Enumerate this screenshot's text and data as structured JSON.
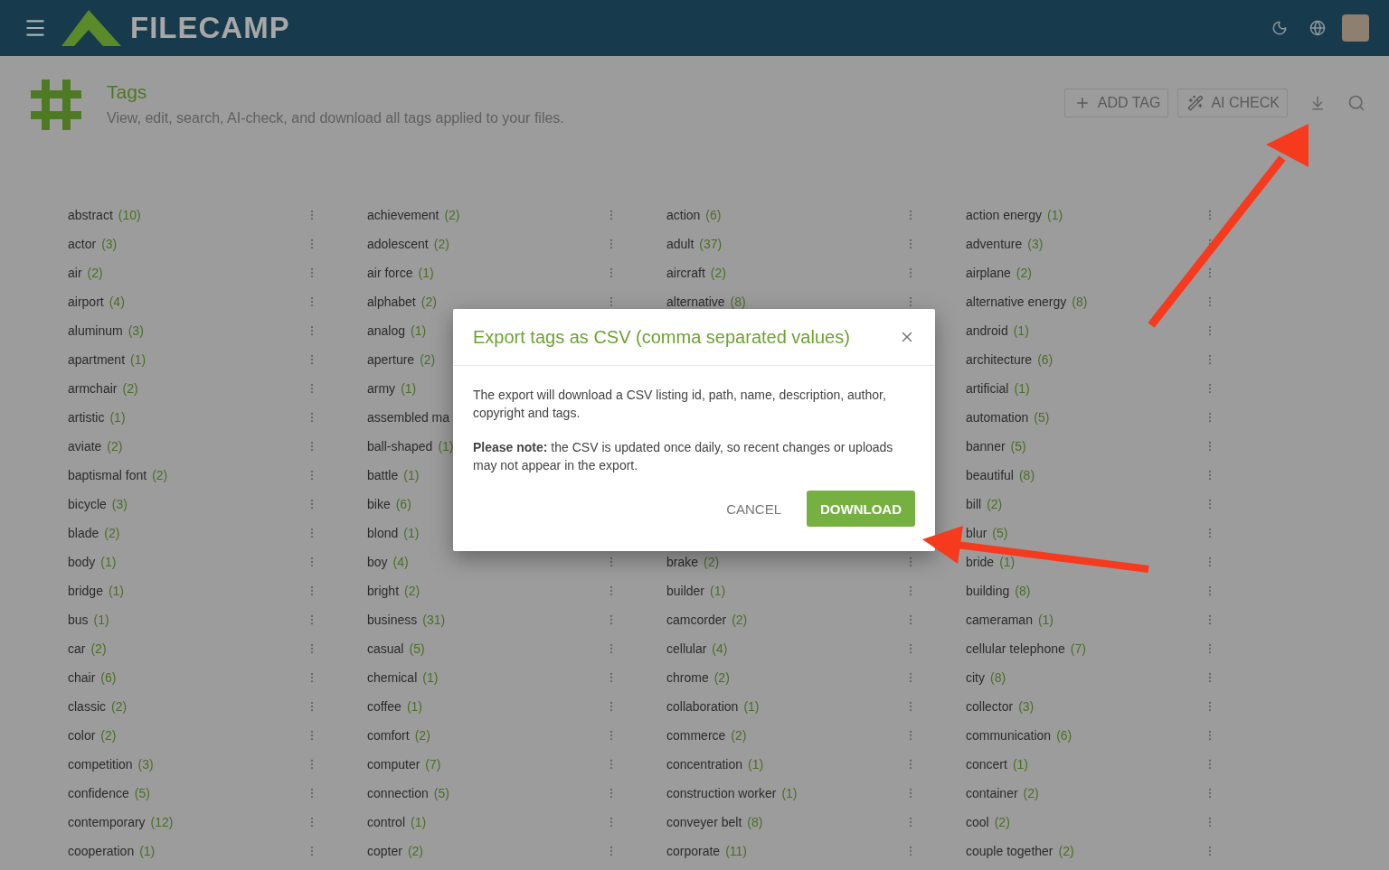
{
  "header": {
    "logo": "FILECAMP"
  },
  "page": {
    "title": "Tags",
    "subtitle": "View, edit, search, AI-check, and download all tags applied to your files."
  },
  "actions": [
    "ADD TAG",
    "AI CHECK"
  ],
  "columns": [
    [
      {
        "kind": "tag",
        "name": "abstract",
        "count": "(10)"
      },
      {
        "kind": "tag",
        "name": "actor",
        "count": "(3)"
      },
      {
        "kind": "tag",
        "name": "air",
        "count": "(2)"
      },
      {
        "kind": "tag",
        "name": "airport",
        "count": "(4)"
      },
      {
        "kind": "tag",
        "name": "aluminum",
        "count": "(3)"
      },
      {
        "kind": "tag",
        "name": "apartment",
        "count": "(1)"
      },
      {
        "kind": "tag",
        "name": "armchair",
        "count": "(2)"
      },
      {
        "kind": "tag",
        "name": "artistic",
        "count": "(1)"
      },
      {
        "kind": "tag",
        "name": "aviate",
        "count": "(2)"
      },
      {
        "kind": "tag",
        "name": "baptismal font",
        "count": "(2)"
      },
      {
        "kind": "tag",
        "name": "bicycle",
        "count": "(3)"
      },
      {
        "kind": "tag",
        "name": "blade",
        "count": "(2)"
      },
      {
        "kind": "tag",
        "name": "body",
        "count": "(1)"
      },
      {
        "kind": "tag",
        "name": "bridge",
        "count": "(1)"
      },
      {
        "kind": "tag",
        "name": "bus",
        "count": "(1)"
      },
      {
        "kind": "tag",
        "name": "car",
        "count": "(2)"
      },
      {
        "kind": "tag",
        "name": "chair",
        "count": "(6)"
      },
      {
        "kind": "tag",
        "name": "classic",
        "count": "(2)"
      },
      {
        "kind": "tag",
        "name": "color",
        "count": "(2)"
      },
      {
        "kind": "tag",
        "name": "competition",
        "count": "(3)"
      },
      {
        "kind": "tag",
        "name": "confidence",
        "count": "(5)"
      },
      {
        "kind": "tag",
        "name": "contemporary",
        "count": "(12)"
      },
      {
        "kind": "tag",
        "name": "cooperation",
        "count": "(1)"
      }
    ],
    [
      {
        "kind": "tag",
        "name": "achievement",
        "count": "(2)"
      },
      {
        "kind": "tag",
        "name": "adolescent",
        "count": "(2)"
      },
      {
        "kind": "tag",
        "name": "air force",
        "count": "(1)"
      },
      {
        "kind": "tag",
        "name": "alphabet",
        "count": "(2)"
      },
      {
        "kind": "partial",
        "name": "analog",
        "count": "(1)"
      },
      {
        "kind": "partial",
        "name": "aperture",
        "count": "(2)"
      },
      {
        "kind": "partial",
        "name": "army",
        "count": "(1)"
      },
      {
        "kind": "partial",
        "name": "assembled ma"
      },
      {
        "kind": "partial",
        "name": "ball-shaped",
        "count": "(1)"
      },
      {
        "kind": "partial",
        "name": "battle",
        "count": "(1)"
      },
      {
        "kind": "partial",
        "name": "bike",
        "count": "(6)"
      },
      {
        "kind": "partial",
        "name": "blond",
        "count": "(1)"
      },
      {
        "kind": "tag",
        "name": "boy",
        "count": "(4)"
      },
      {
        "kind": "tag",
        "name": "bright",
        "count": "(2)"
      },
      {
        "kind": "tag",
        "name": "business",
        "count": "(31)"
      },
      {
        "kind": "tag",
        "name": "casual",
        "count": "(5)"
      },
      {
        "kind": "tag",
        "name": "chemical",
        "count": "(1)"
      },
      {
        "kind": "tag",
        "name": "coffee",
        "count": "(1)"
      },
      {
        "kind": "tag",
        "name": "comfort",
        "count": "(2)"
      },
      {
        "kind": "tag",
        "name": "computer",
        "count": "(7)"
      },
      {
        "kind": "tag",
        "name": "connection",
        "count": "(5)"
      },
      {
        "kind": "tag",
        "name": "control",
        "count": "(1)"
      },
      {
        "kind": "tag",
        "name": "copter",
        "count": "(2)"
      }
    ],
    [
      {
        "kind": "tag",
        "name": "action",
        "count": "(6)"
      },
      {
        "kind": "tag",
        "name": "adult",
        "count": "(37)"
      },
      {
        "kind": "tag",
        "name": "aircraft",
        "count": "(2)"
      },
      {
        "kind": "tag",
        "name": "alternative",
        "count": "(8)"
      },
      {
        "kind": "covered"
      },
      {
        "kind": "covered"
      },
      {
        "kind": "covered"
      },
      {
        "kind": "covered"
      },
      {
        "kind": "covered"
      },
      {
        "kind": "covered"
      },
      {
        "kind": "covered"
      },
      {
        "kind": "covered"
      },
      {
        "kind": "tag",
        "name": "brake",
        "count": "(2)"
      },
      {
        "kind": "tag",
        "name": "builder",
        "count": "(1)"
      },
      {
        "kind": "tag",
        "name": "camcorder",
        "count": "(2)"
      },
      {
        "kind": "tag",
        "name": "cellular",
        "count": "(4)"
      },
      {
        "kind": "tag",
        "name": "chrome",
        "count": "(2)"
      },
      {
        "kind": "tag",
        "name": "collaboration",
        "count": "(1)"
      },
      {
        "kind": "tag",
        "name": "commerce",
        "count": "(2)"
      },
      {
        "kind": "tag",
        "name": "concentration",
        "count": "(1)"
      },
      {
        "kind": "tag",
        "name": "construction worker",
        "count": "(1)"
      },
      {
        "kind": "tag",
        "name": "conveyer belt",
        "count": "(8)"
      },
      {
        "kind": "tag",
        "name": "corporate",
        "count": "(11)"
      }
    ],
    [
      {
        "kind": "tag",
        "name": "action energy",
        "count": "(1)"
      },
      {
        "kind": "tag",
        "name": "adventure",
        "count": "(3)"
      },
      {
        "kind": "tag",
        "name": "airplane",
        "count": "(2)"
      },
      {
        "kind": "tag",
        "name": "alternative energy",
        "count": "(8)"
      },
      {
        "kind": "tag",
        "name": "android",
        "count": "(1)"
      },
      {
        "kind": "tag",
        "name": "architecture",
        "count": "(6)"
      },
      {
        "kind": "tag",
        "name": "artificial",
        "count": "(1)"
      },
      {
        "kind": "tag",
        "name": "automation",
        "count": "(5)"
      },
      {
        "kind": "tag",
        "name": "banner",
        "count": "(5)"
      },
      {
        "kind": "tag",
        "name": "beautiful",
        "count": "(8)"
      },
      {
        "kind": "tag",
        "name": "bill",
        "count": "(2)"
      },
      {
        "kind": "tag",
        "name": "blur",
        "count": "(5)"
      },
      {
        "kind": "tag",
        "name": "bride",
        "count": "(1)"
      },
      {
        "kind": "tag",
        "name": "building",
        "count": "(8)"
      },
      {
        "kind": "tag",
        "name": "cameraman",
        "count": "(1)"
      },
      {
        "kind": "tag",
        "name": "cellular telephone",
        "count": "(7)"
      },
      {
        "kind": "tag",
        "name": "city",
        "count": "(8)"
      },
      {
        "kind": "tag",
        "name": "collector",
        "count": "(3)"
      },
      {
        "kind": "tag",
        "name": "communication",
        "count": "(6)"
      },
      {
        "kind": "tag",
        "name": "concert",
        "count": "(1)"
      },
      {
        "kind": "tag",
        "name": "container",
        "count": "(2)"
      },
      {
        "kind": "tag",
        "name": "cool",
        "count": "(2)"
      },
      {
        "kind": "tag",
        "name": "couple together",
        "count": "(2)"
      }
    ]
  ],
  "dialog": {
    "title": "Export tags as CSV (comma separated values)",
    "paragraphs": [
      "The export will download a CSV listing id, path, name, description, author, copyright and tags.",
      "**Please note:** the CSV is updated once daily, so recent changes or uploads may not appear in the export."
    ],
    "cancel": "CANCEL",
    "confirm": "DOWNLOAD"
  }
}
